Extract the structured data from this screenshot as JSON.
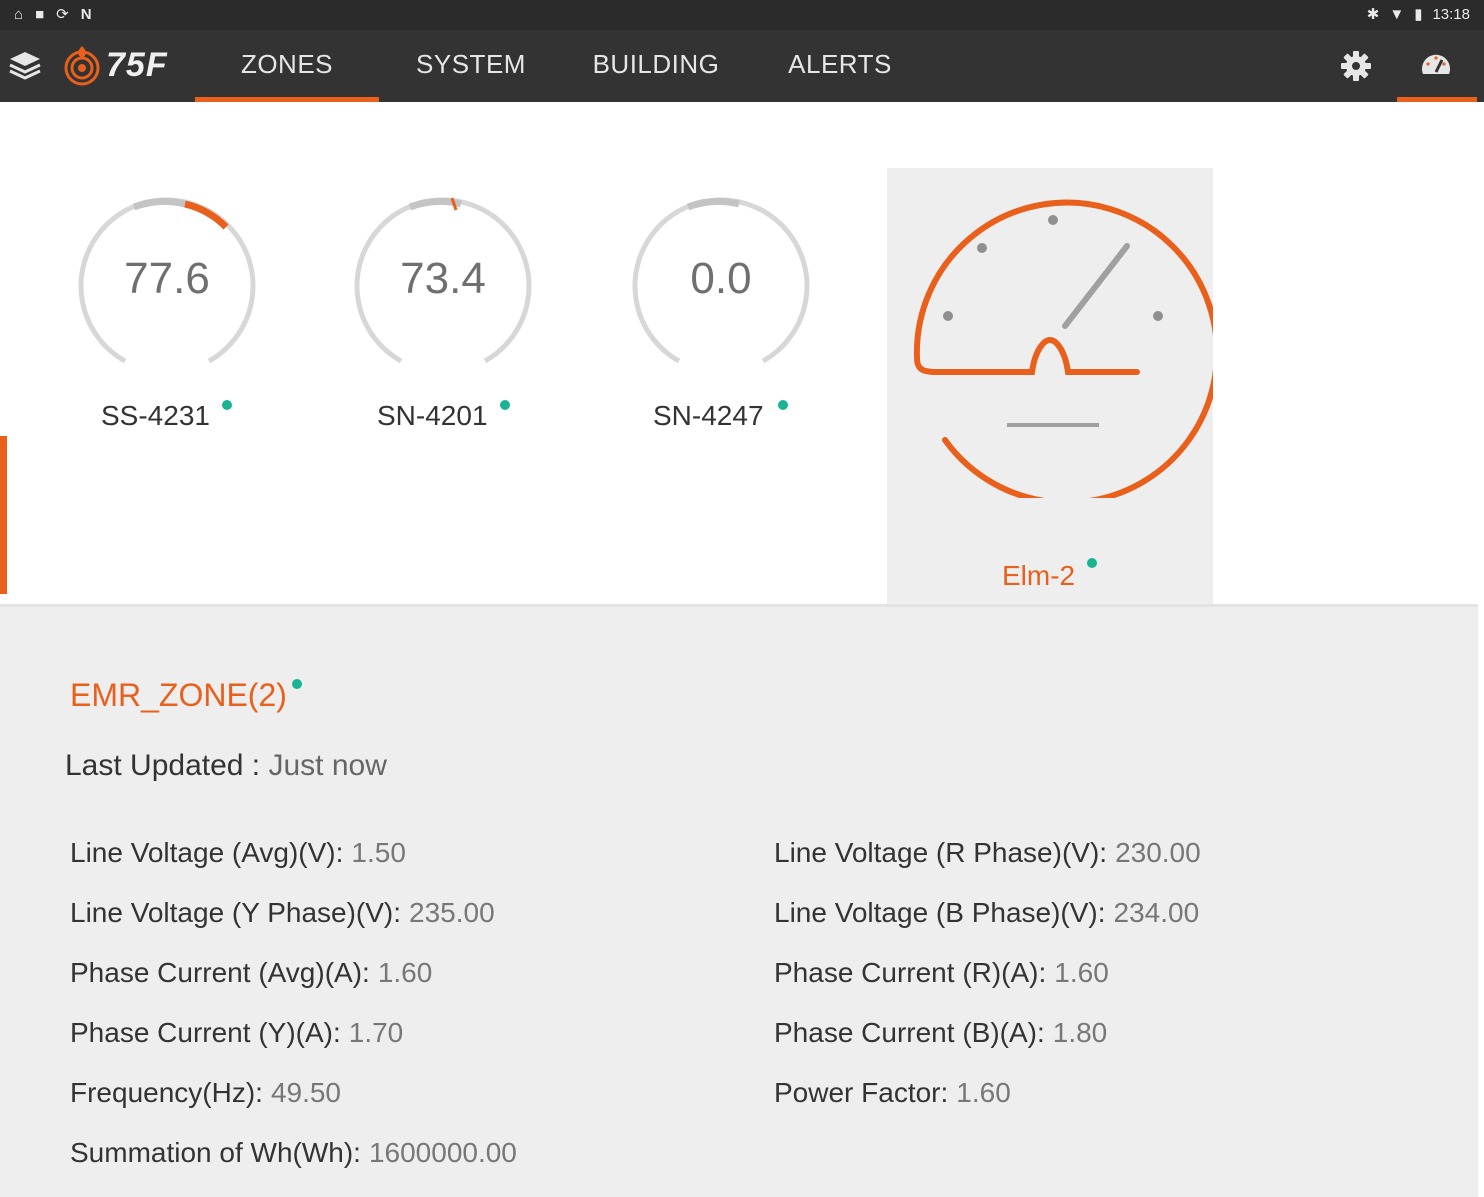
{
  "status_bar": {
    "time": "13:18"
  },
  "nav": {
    "logo": "75F",
    "tabs": [
      "ZONES",
      "SYSTEM",
      "BUILDING",
      "ALERTS"
    ],
    "active_tab": "ZONES",
    "accent_color": "#e8601c"
  },
  "zones": [
    {
      "name": "SS-4231",
      "value": "77.6"
    },
    {
      "name": "SN-4201",
      "value": "73.4"
    },
    {
      "name": "SN-4247",
      "value": "0.0"
    },
    {
      "name": "Elm-2",
      "selected": true
    }
  ],
  "detail": {
    "title": "EMR_ZONE(2)",
    "last_updated_label": "Last Updated : ",
    "last_updated_value": "Just now",
    "left": [
      {
        "label": "Line Voltage (Avg)(V):",
        "value": "1.50"
      },
      {
        "label": "Line Voltage (Y Phase)(V):",
        "value": "235.00"
      },
      {
        "label": "Phase Current (Avg)(A):",
        "value": "1.60"
      },
      {
        "label": "Phase Current (Y)(A):",
        "value": "1.70"
      },
      {
        "label": "Frequency(Hz):",
        "value": "49.50"
      },
      {
        "label": "Summation of Wh(Wh):",
        "value": "1600000.00"
      }
    ],
    "right": [
      {
        "label": "Line Voltage (R Phase)(V):",
        "value": "230.00"
      },
      {
        "label": "Line Voltage (B Phase)(V):",
        "value": "234.00"
      },
      {
        "label": "Phase Current (R)(A):",
        "value": "1.60"
      },
      {
        "label": "Phase Current (B)(A):",
        "value": "1.80"
      },
      {
        "label": "Power Factor:",
        "value": "1.60"
      }
    ]
  }
}
